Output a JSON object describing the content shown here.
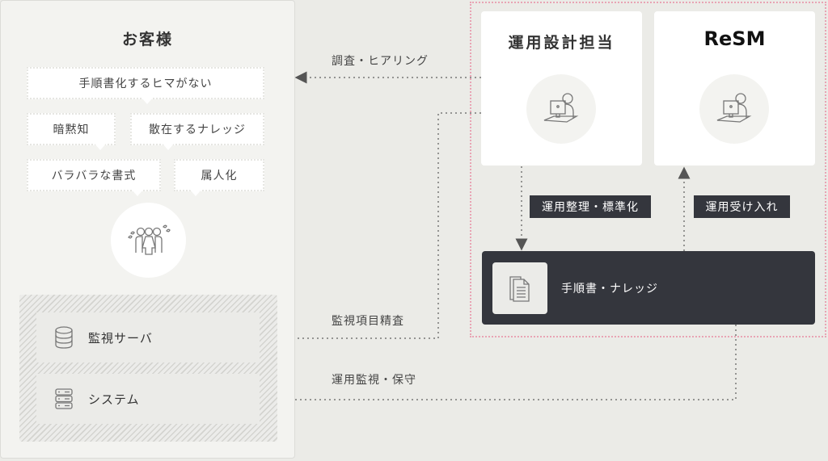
{
  "customer": {
    "title": "お客様",
    "pain_points": [
      "手順書化するヒマがない",
      "暗黙知",
      "散在するナレッジ",
      "バラバラな書式",
      "属人化"
    ],
    "people_icon": "worried-people-icon",
    "systems": [
      {
        "label": "監視サーバ",
        "icon": "database-icon"
      },
      {
        "label": "システム",
        "icon": "server-rack-icon"
      }
    ]
  },
  "team": {
    "designer": {
      "title": "運用設計担当",
      "icon": "person-at-computer-icon"
    },
    "resm": {
      "logo": "ReSM",
      "icon": "person-at-computer-icon"
    },
    "tags": [
      "運用整理・標準化",
      "運用受け入れ"
    ],
    "knowledge": {
      "label": "手順書・ナレッジ",
      "icon": "documents-icon"
    }
  },
  "flows": [
    {
      "label": "調査・ヒアリング",
      "from": "運用設計担当",
      "to": "お客様"
    },
    {
      "label": "監視項目精査",
      "from": "運用設計担当",
      "to": "監視サーバ"
    },
    {
      "label": "運用監視・保守",
      "from": "手順書・ナレッジ",
      "to": "システム"
    },
    {
      "label": "運用整理・標準化",
      "from": "運用設計担当",
      "to": "手順書・ナレッジ"
    },
    {
      "label": "運用受け入れ",
      "from": "手順書・ナレッジ",
      "to": "ReSM"
    }
  ],
  "colors": {
    "background": "#ebebe7",
    "panel": "#f3f3f0",
    "dark": "#34363d",
    "team_border": "#e8a4b4",
    "arrow": "#555555"
  }
}
